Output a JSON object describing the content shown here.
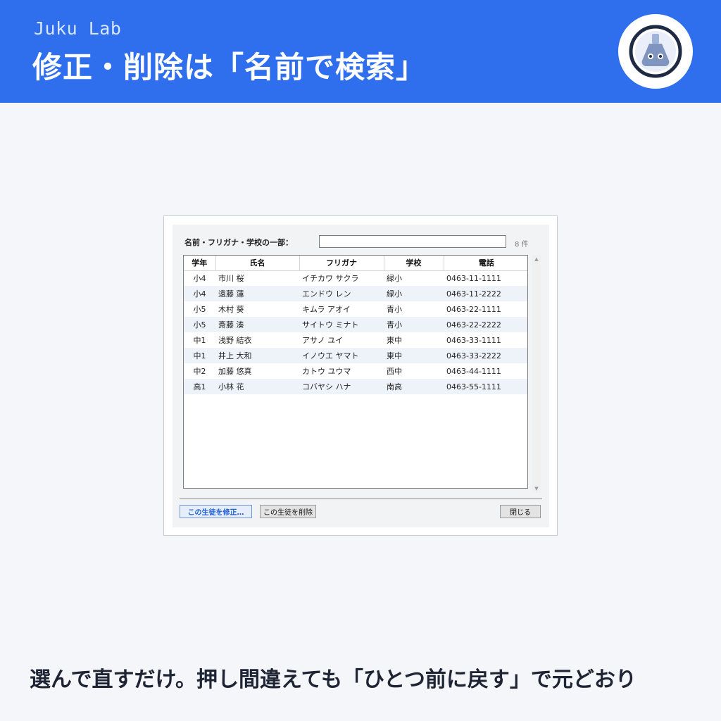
{
  "header": {
    "brand": "Juku Lab",
    "title": "修正・削除は「名前で検索」",
    "logo_icon": "flask-robot-icon",
    "background_color": "#2f6fee"
  },
  "dialog": {
    "search_label": "名前・フリガナ・学校の一部：",
    "search_value": "",
    "count": "8 件",
    "columns": [
      "学年",
      "氏名",
      "フリガナ",
      "学校",
      "電話"
    ],
    "rows": [
      [
        "小4",
        "市川 桜",
        "イチカワ サクラ",
        "緑小",
        "0463-11-1111"
      ],
      [
        "小4",
        "遠藤 蓮",
        "エンドウ レン",
        "緑小",
        "0463-11-2222"
      ],
      [
        "小5",
        "木村 葵",
        "キムラ アオイ",
        "青小",
        "0463-22-1111"
      ],
      [
        "小5",
        "斎藤 湊",
        "サイトウ ミナト",
        "青小",
        "0463-22-2222"
      ],
      [
        "中1",
        "浅野 結衣",
        "アサノ ユイ",
        "東中",
        "0463-33-1111"
      ],
      [
        "中1",
        "井上 大和",
        "イノウエ ヤマト",
        "東中",
        "0463-33-2222"
      ],
      [
        "中2",
        "加藤 悠真",
        "カトウ ユウマ",
        "西中",
        "0463-44-1111"
      ],
      [
        "高1",
        "小林 花",
        "コバヤシ ハナ",
        "南高",
        "0463-55-1111"
      ]
    ],
    "edit_button": "この生徒を修正…",
    "delete_button": "この生徒を削除",
    "close_button": "閉じる",
    "scroll_up_icon": "chevron-up-icon",
    "scroll_down_icon": "chevron-down-icon"
  },
  "caption": "選んで直すだけ。押し間違えても「ひとつ前に戻す」で元どおり"
}
